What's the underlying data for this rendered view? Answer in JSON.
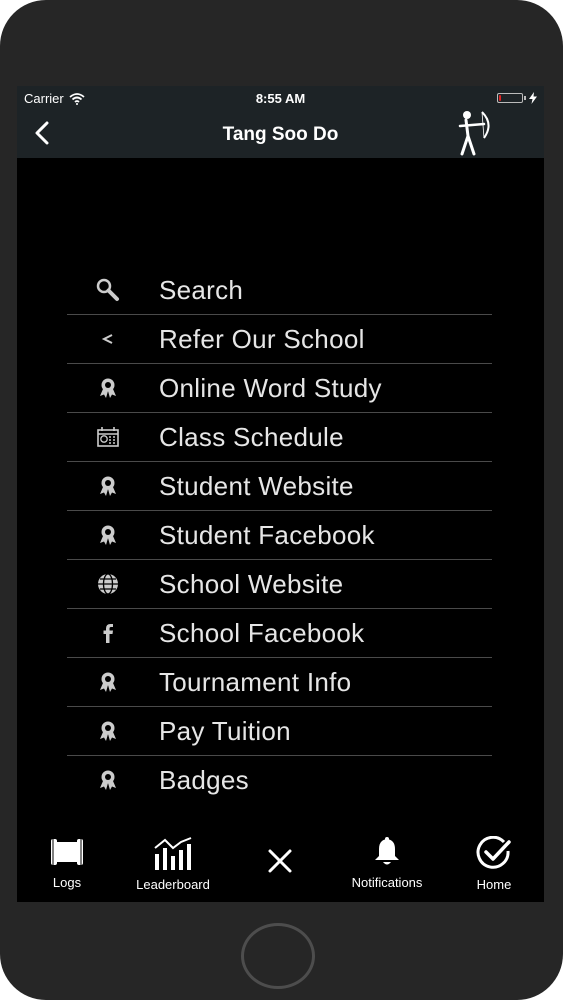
{
  "status_bar": {
    "carrier": "Carrier",
    "time": "8:55 AM",
    "battery_level": 0.1,
    "battery_color": "#e02020"
  },
  "nav": {
    "title": "Tang Soo Do",
    "back_icon": "chevron-left-icon",
    "logo_icon": "archer-icon"
  },
  "menu": {
    "items": [
      {
        "label": "Search",
        "icon": "search-icon"
      },
      {
        "label": "Refer Our School",
        "icon": "share-icon"
      },
      {
        "label": "Online Word Study",
        "icon": "award-icon"
      },
      {
        "label": "Class Schedule",
        "icon": "calendar-icon"
      },
      {
        "label": "Student Website",
        "icon": "award-icon"
      },
      {
        "label": "Student Facebook",
        "icon": "award-icon"
      },
      {
        "label": "School Website",
        "icon": "globe-icon"
      },
      {
        "label": "School Facebook",
        "icon": "facebook-icon"
      },
      {
        "label": "Tournament Info",
        "icon": "award-icon"
      },
      {
        "label": "Pay Tuition",
        "icon": "award-icon"
      },
      {
        "label": "Badges",
        "icon": "award-icon"
      }
    ]
  },
  "tabbar": {
    "logs": "Logs",
    "leaderboard": "Leaderboard",
    "close_icon": "close-icon",
    "notifications": "Notifications",
    "home": "Home"
  },
  "colors": {
    "bar_background": "#1d2326",
    "screen_background": "#000000",
    "divider": "#4a4a4a",
    "text": "#e6e6e6"
  }
}
